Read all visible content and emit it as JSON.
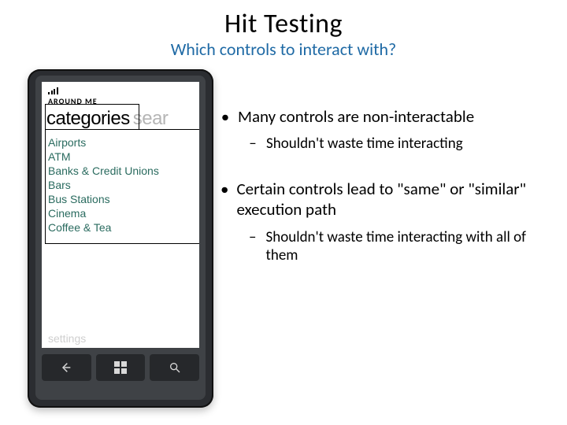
{
  "slide": {
    "title": "Hit Testing",
    "subtitle": "Which controls to interact with?",
    "bullets": [
      {
        "text": "Many controls are non-interactable",
        "sub": [
          "Shouldn't waste time interacting"
        ]
      },
      {
        "text": "Certain controls lead to \"same\" or \"similar\" execution path",
        "sub": [
          "Shouldn't waste time interacting  with all of them"
        ]
      }
    ]
  },
  "phone": {
    "app_title": "AROUND ME",
    "tab_active": "categories",
    "tab_ghost": "sear",
    "settings_label": "settings",
    "list": [
      "Airports",
      "ATM",
      "Banks & Credit Unions",
      "Bars",
      "Bus Stations",
      "Cinema",
      "Coffee & Tea"
    ]
  },
  "glyphs": {
    "bullet_dot": "•",
    "bullet_dash": "–"
  }
}
